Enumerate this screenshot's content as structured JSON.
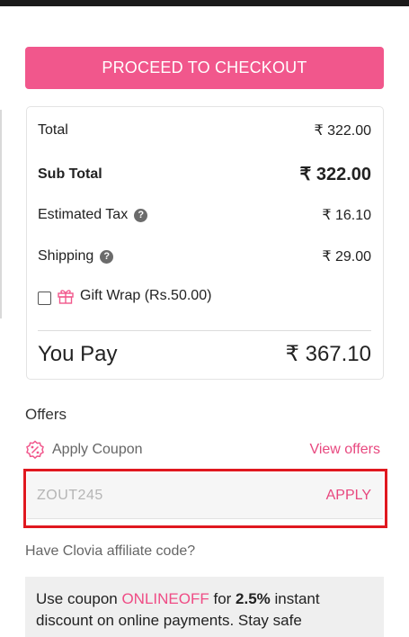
{
  "checkout": {
    "button_label": "PROCEED TO CHECKOUT"
  },
  "summary": {
    "total": {
      "label": "Total",
      "value": "₹ 322.00"
    },
    "subtotal": {
      "label": "Sub Total",
      "value": "₹ 322.00"
    },
    "tax": {
      "label": "Estimated Tax",
      "value": "₹ 16.10"
    },
    "shipping": {
      "label": "Shipping",
      "value": "₹ 29.00"
    },
    "gift_wrap": {
      "label": "Gift Wrap (Rs.50.00)",
      "checked": false
    },
    "you_pay": {
      "label": "You Pay",
      "value": "₹ 367.10"
    }
  },
  "offers": {
    "title": "Offers",
    "apply_coupon_label": "Apply Coupon",
    "view_offers_label": "View offers",
    "coupon_placeholder": "ZOUT245",
    "apply_label": "APPLY"
  },
  "affiliate": {
    "label": "Have Clovia affiliate code?"
  },
  "promo": {
    "prefix": "Use coupon ",
    "code": "ONLINEOFF",
    "mid": " for ",
    "percent": "2.5%",
    "suffix": " instant discount on online payments. Stay safe"
  },
  "colors": {
    "accent": "#f1578c",
    "link": "#e8487f",
    "highlight": "#e0181f"
  },
  "icons": {
    "help": "question-circle-icon",
    "gift": "gift-icon",
    "coupon": "coupon-percent-icon"
  }
}
